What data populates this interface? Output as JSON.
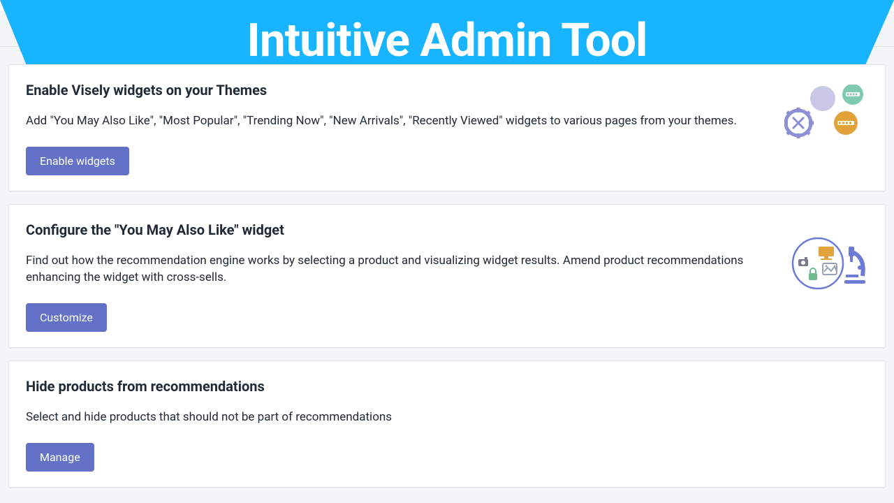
{
  "banner": {
    "title": "Intuitive Admin Tool"
  },
  "cards": [
    {
      "title": "Enable Visely widgets on your Themes",
      "description": "Add \"You May Also Like\", \"Most Popular\", \"Trending Now\", \"New Arrivals\", \"Recently Viewed\" widgets to various pages from your themes.",
      "button": "Enable widgets"
    },
    {
      "title": "Configure the \"You May Also Like\" widget",
      "description": "Find out how the recommendation engine works by selecting a product and visualizing widget results. Amend product recommendations enhancing the widget with cross-sells.",
      "button": "Customize"
    },
    {
      "title": "Hide products from recommendations",
      "description": "Select and hide products that should not be part of recommendations",
      "button": "Manage"
    }
  ]
}
